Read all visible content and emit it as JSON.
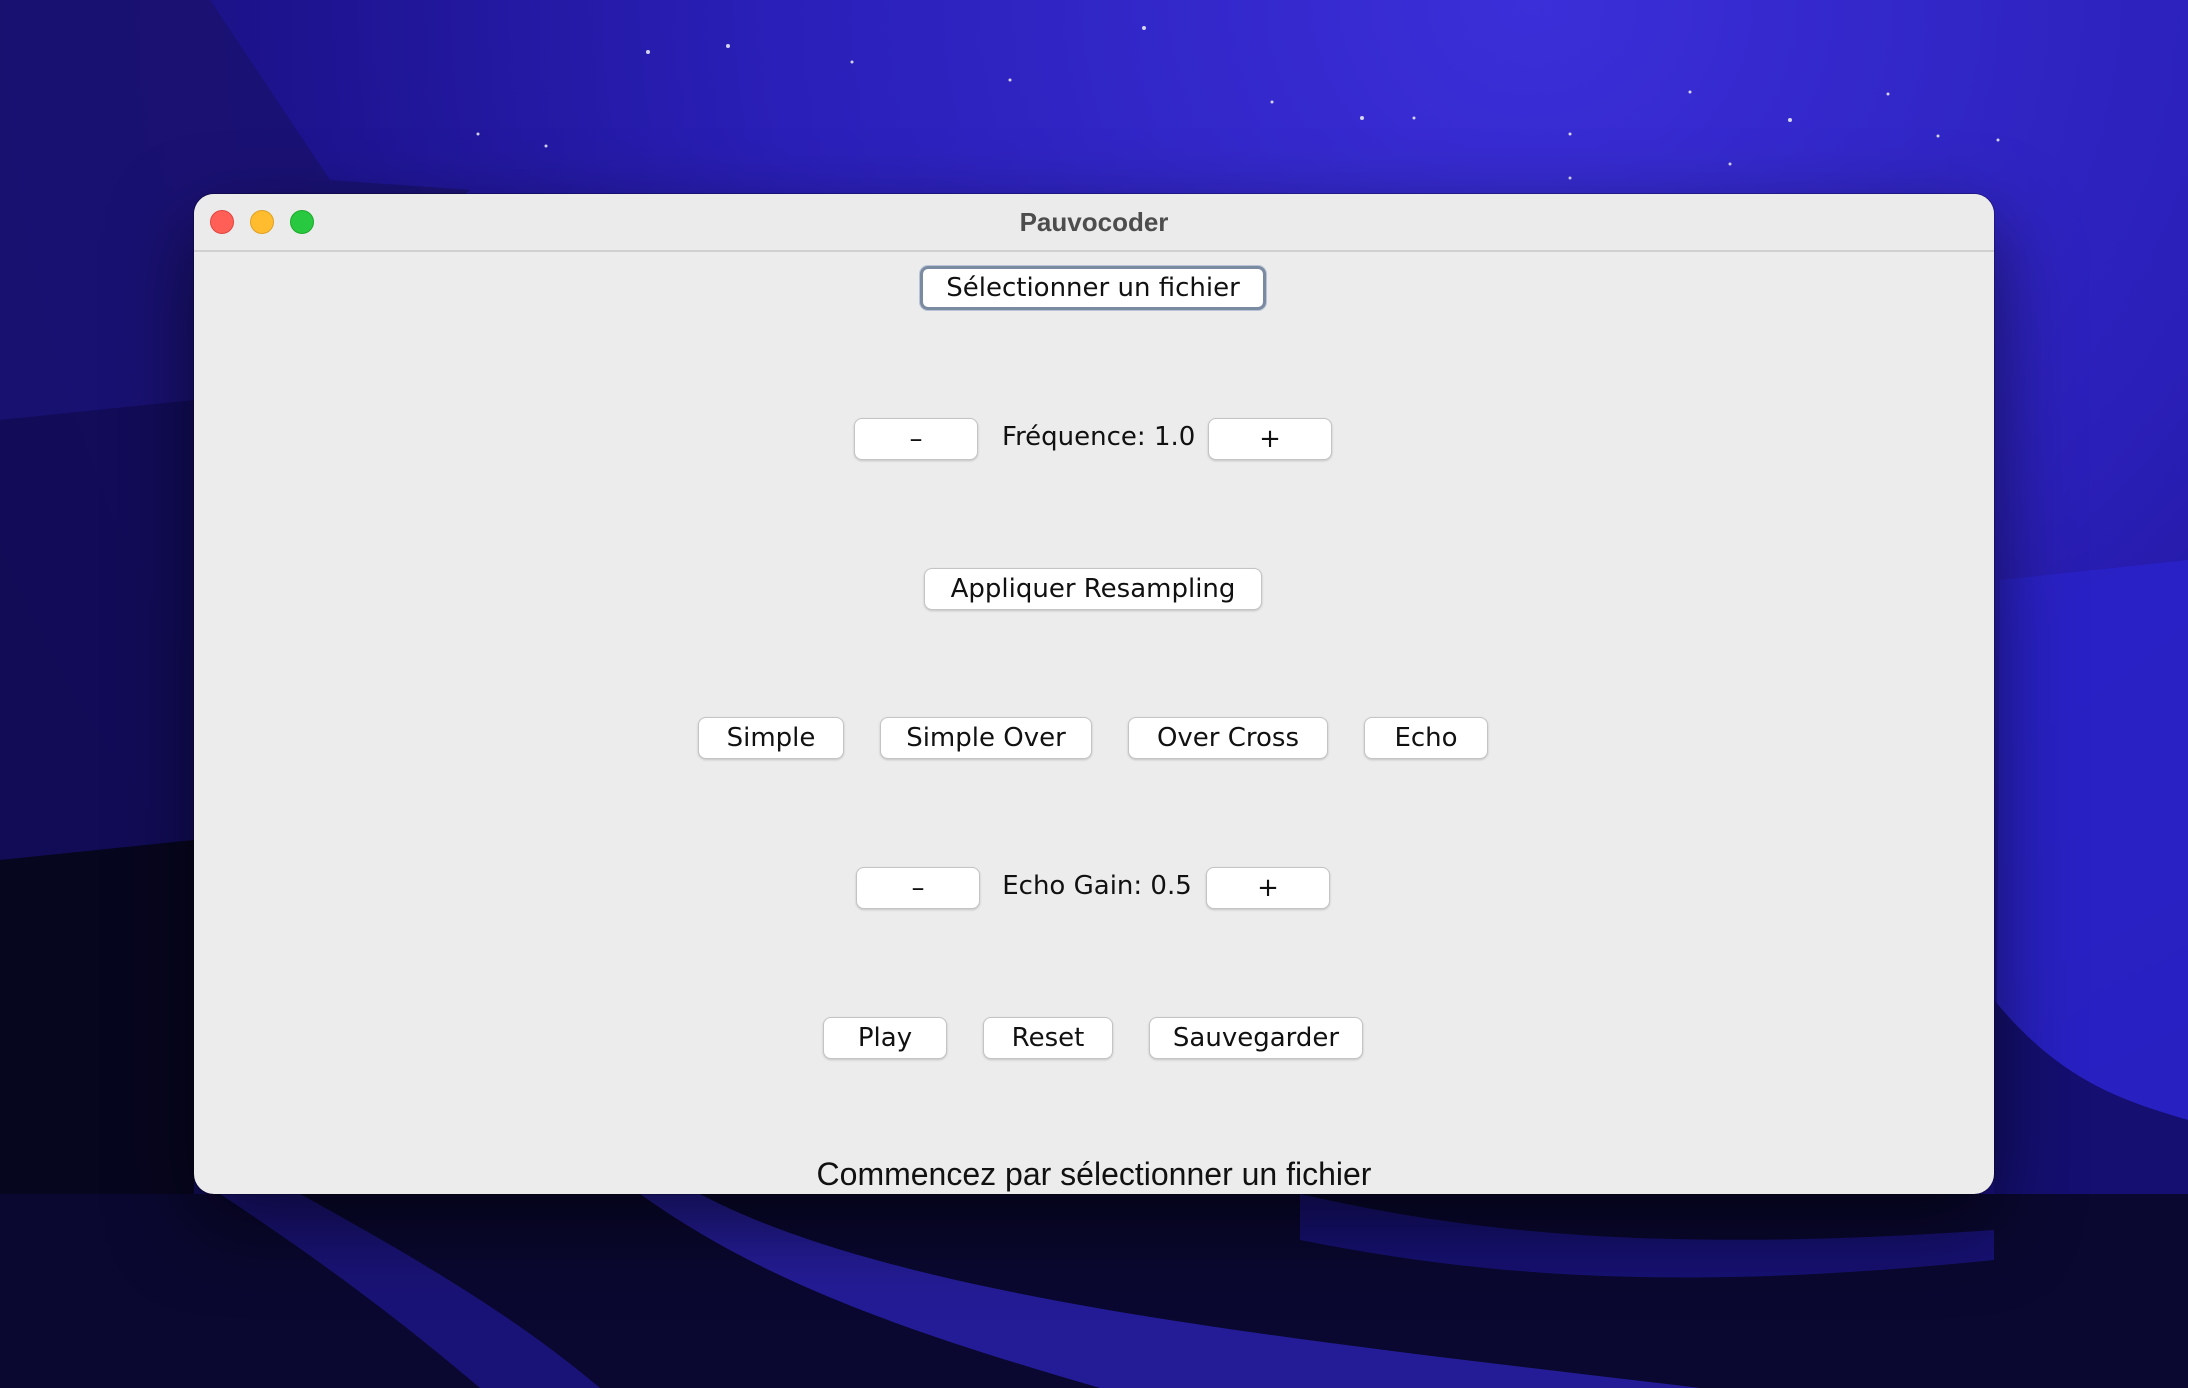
{
  "window": {
    "title": "Pauvocoder"
  },
  "file": {
    "select_label": "Sélectionner un fichier"
  },
  "frequency": {
    "minus_label": "–",
    "label": "Fréquence: 1.0",
    "plus_label": "+"
  },
  "resampling": {
    "apply_label": "Appliquer Resampling"
  },
  "effects": {
    "simple": "Simple",
    "simple_over": "Simple Over",
    "over_cross": "Over Cross",
    "echo": "Echo"
  },
  "echo_gain": {
    "minus_label": "–",
    "label": "Echo Gain: 0.5",
    "plus_label": "+"
  },
  "actions": {
    "play": "Play",
    "reset": "Reset",
    "save": "Sauvegarder"
  },
  "status": {
    "text": "Commencez par sélectionner un fichier"
  },
  "colors": {
    "close": "#ff5f57",
    "minimize": "#febc2e",
    "maximize": "#28c840"
  }
}
